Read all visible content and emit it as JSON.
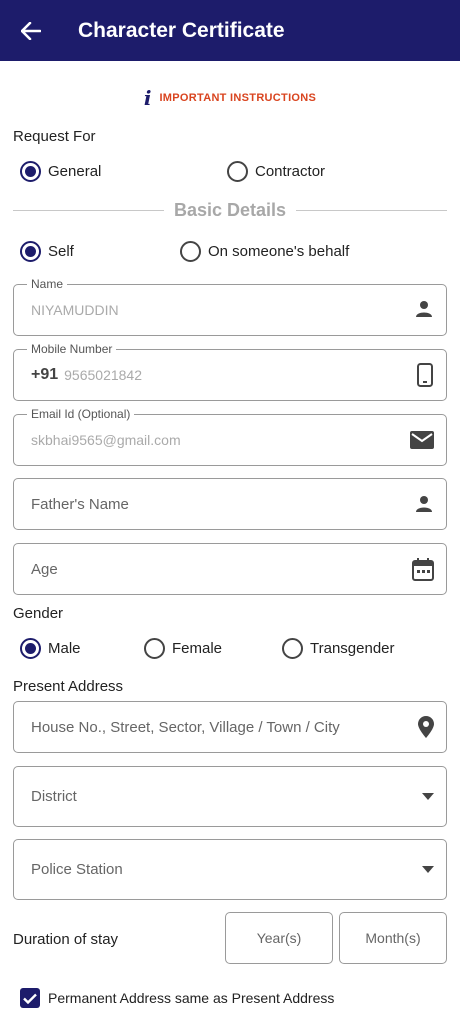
{
  "header": {
    "title": "Character Certificate",
    "back_icon": "arrow-left-icon",
    "background": "#1d1c6b"
  },
  "instructions": {
    "icon_text": "i",
    "label": "IMPORTANT INSTRUCTIONS",
    "color": "#d9441f"
  },
  "request_for": {
    "label": "Request For",
    "options": [
      {
        "label": "General",
        "selected": true
      },
      {
        "label": "Contractor",
        "selected": false
      }
    ]
  },
  "basic_details": {
    "title": "Basic Details",
    "applicant_options": [
      {
        "label": "Self",
        "selected": true
      },
      {
        "label": "On someone's behalf",
        "selected": false
      }
    ],
    "name": {
      "label": "Name",
      "value": "NIYAMUDDIN",
      "icon": "person-icon"
    },
    "mobile": {
      "label": "Mobile Number",
      "prefix": "+91",
      "value": "9565021842",
      "icon": "phone-icon"
    },
    "email": {
      "label": "Email Id (Optional)",
      "value": "skbhai9565@gmail.com",
      "icon": "mail-icon"
    },
    "father_name": {
      "placeholder": "Father's Name",
      "icon": "person-icon"
    },
    "age": {
      "placeholder": "Age",
      "icon": "calendar-icon"
    }
  },
  "gender": {
    "label": "Gender",
    "options": [
      {
        "label": "Male",
        "selected": true
      },
      {
        "label": "Female",
        "selected": false
      },
      {
        "label": "Transgender",
        "selected": false
      }
    ]
  },
  "present_address": {
    "label": "Present Address",
    "address": {
      "placeholder": "House No., Street, Sector, Village / Town / City",
      "icon": "location-pin-icon"
    },
    "district": {
      "placeholder": "District"
    },
    "police_station": {
      "placeholder": "Police Station"
    }
  },
  "duration": {
    "label": "Duration of stay",
    "years_placeholder": "Year(s)",
    "months_placeholder": "Month(s)"
  },
  "permanent_same": {
    "label": "Permanent Address same as Present Address",
    "checked": true
  }
}
